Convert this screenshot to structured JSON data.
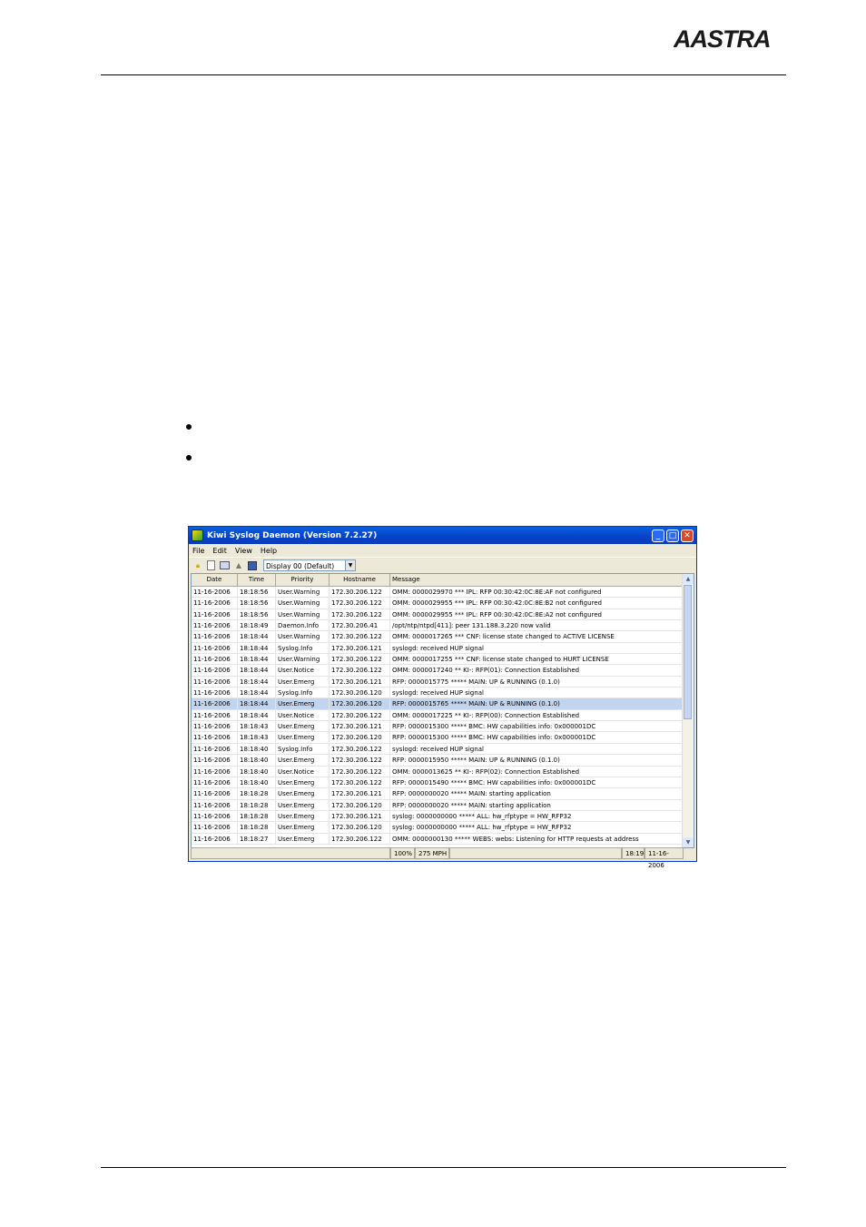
{
  "brand": {
    "logo_text": "AASTRA"
  },
  "window": {
    "title": "Kiwi Syslog Daemon (Version 7.2.27)",
    "controls": {
      "minimize": "_",
      "maximize": "□",
      "close": "✕"
    },
    "menu": [
      "File",
      "Edit",
      "View",
      "Help"
    ],
    "toolbar": {
      "icons": [
        "lock-icon",
        "document-icon",
        "display-icon",
        "warning-icon",
        "alarm-icon"
      ],
      "display_select": "Display 00 (Default)"
    },
    "columns": [
      "Date",
      "Time",
      "Priority",
      "Hostname",
      "Message"
    ],
    "rows": [
      [
        "11-16-2006",
        "18:18:56",
        "User.Warning",
        "172.30.206.122",
        "OMM: 0000029970 ***   IPL: RFP 00:30:42:0C:8E:AF not configured"
      ],
      [
        "11-16-2006",
        "18:18:56",
        "User.Warning",
        "172.30.206.122",
        "OMM: 0000029955 ***   IPL: RFP 00:30:42:0C:8E:B2 not configured"
      ],
      [
        "11-16-2006",
        "18:18:56",
        "User.Warning",
        "172.30.206.122",
        "OMM: 0000029955 ***   IPL: RFP 00:30:42:0C:8E:A2 not configured"
      ],
      [
        "11-16-2006",
        "18:18:49",
        "Daemon.Info",
        "172.30.206.41",
        "/opt/ntp/ntpd[411]: peer 131.188.3.220 now valid"
      ],
      [
        "11-16-2006",
        "18:18:44",
        "User.Warning",
        "172.30.206.122",
        "OMM: 0000017265 ***   CNF: license state changed to ACTIVE LICENSE"
      ],
      [
        "11-16-2006",
        "18:18:44",
        "Syslog.Info",
        "172.30.206.121",
        "syslogd: received HUP signal"
      ],
      [
        "11-16-2006",
        "18:18:44",
        "User.Warning",
        "172.30.206.122",
        "OMM: 0000017255 ***   CNF: license state changed to HURT LICENSE"
      ],
      [
        "11-16-2006",
        "18:18:44",
        "User.Notice",
        "172.30.206.122",
        "OMM: 0000017240 **    KI-: RFP(01): Connection Established"
      ],
      [
        "11-16-2006",
        "18:18:44",
        "User.Emerg",
        "172.30.206.121",
        "RFP: 0000015775 ***** MAIN: UP & RUNNING (0.1.0)"
      ],
      [
        "11-16-2006",
        "18:18:44",
        "Syslog.Info",
        "172.30.206.120",
        "syslogd: received HUP signal"
      ],
      [
        "11-16-2006",
        "18:18:44",
        "User.Emerg",
        "172.30.206.120",
        "RFP: 0000015765 ***** MAIN: UP & RUNNING (0.1.0)"
      ],
      [
        "11-16-2006",
        "18:18:44",
        "User.Notice",
        "172.30.206.122",
        "OMM: 0000017225 **    KI-: RFP(00): Connection Established"
      ],
      [
        "11-16-2006",
        "18:18:43",
        "User.Emerg",
        "172.30.206.121",
        "RFP: 0000015300 ***** BMC:  HW capabilities info: 0x000001DC"
      ],
      [
        "11-16-2006",
        "18:18:43",
        "User.Emerg",
        "172.30.206.120",
        "RFP: 0000015300 ***** BMC:  HW capabilities info: 0x000001DC"
      ],
      [
        "11-16-2006",
        "18:18:40",
        "Syslog.Info",
        "172.30.206.122",
        "syslogd: received HUP signal"
      ],
      [
        "11-16-2006",
        "18:18:40",
        "User.Emerg",
        "172.30.206.122",
        "RFP: 0000015950 ***** MAIN: UP & RUNNING (0.1.0)"
      ],
      [
        "11-16-2006",
        "18:18:40",
        "User.Notice",
        "172.30.206.122",
        "OMM: 0000013625 **    KI-: RFP(02): Connection Established"
      ],
      [
        "11-16-2006",
        "18:18:40",
        "User.Emerg",
        "172.30.206.122",
        "RFP: 0000015490 ***** BMC:  HW capabilities info: 0x000001DC"
      ],
      [
        "11-16-2006",
        "18:18:28",
        "User.Emerg",
        "172.30.206.121",
        "RFP: 0000000020 ***** MAIN: starting application"
      ],
      [
        "11-16-2006",
        "18:18:28",
        "User.Emerg",
        "172.30.206.120",
        "RFP: 0000000020 ***** MAIN: starting application"
      ],
      [
        "11-16-2006",
        "18:18:28",
        "User.Emerg",
        "172.30.206.121",
        "syslog: 0000000000 ***** ALL: hw_rfptype = HW_RFP32"
      ],
      [
        "11-16-2006",
        "18:18:28",
        "User.Emerg",
        "172.30.206.120",
        "syslog: 0000000000 ***** ALL: hw_rfptype = HW_RFP32"
      ],
      [
        "11-16-2006",
        "18:18:27",
        "User.Emerg",
        "172.30.206.122",
        "OMM: 0000000130 ***** WEBS: webs: Listening for HTTP requests at address"
      ]
    ],
    "selected_row": 10,
    "status": {
      "percent": "100%",
      "rate": "275 MPH",
      "time": "18:19",
      "date": "11-16-2006"
    }
  }
}
